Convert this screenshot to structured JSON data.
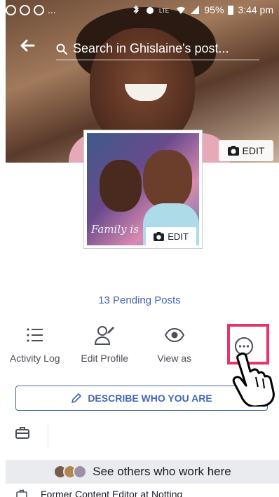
{
  "status_bar": {
    "left_extra": "...",
    "battery": "95%",
    "time": "3:44 pm"
  },
  "header": {
    "search_placeholder": "Search in Ghislaine's post..."
  },
  "cover": {
    "edit_label": "EDIT"
  },
  "profile_picture": {
    "edit_label": "EDIT",
    "overlay_text": "Family is"
  },
  "pending_posts": "13 Pending Posts",
  "actions": [
    {
      "label": "Activity Log",
      "icon": "list-icon"
    },
    {
      "label": "Edit Profile",
      "icon": "person-edit-icon"
    },
    {
      "label": "View as",
      "icon": "eye-icon"
    },
    {
      "label": "",
      "icon": "more-icon"
    }
  ],
  "describe_button": "DESCRIBE WHO YOU ARE",
  "see_others": "See others who work here",
  "former_job": "Former Content Editor at Notting",
  "colors": {
    "link_blue": "#4267b2",
    "highlight_pink": "#e8336b",
    "banner_gray": "#e9ebee"
  }
}
